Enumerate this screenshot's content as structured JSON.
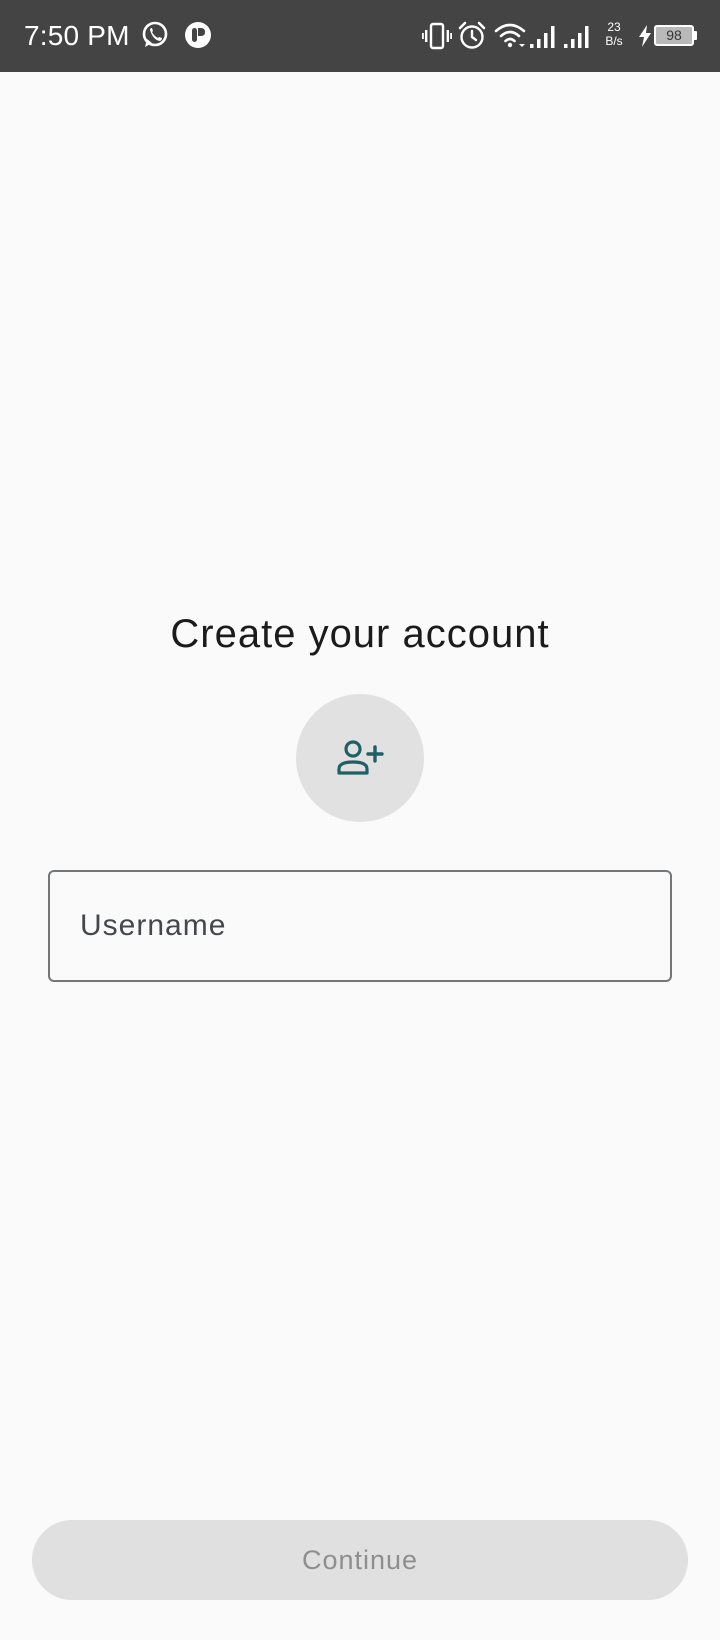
{
  "status_bar": {
    "time": "7:50 PM",
    "icons": [
      "whatsapp-icon",
      "truecaller-icon",
      "vibrate-icon",
      "alarm-icon",
      "wifi-icon",
      "signal-icon",
      "signal-icon",
      "charging-icon"
    ],
    "net_speed_value": "23",
    "net_speed_unit": "B/s",
    "battery_level": "98"
  },
  "main": {
    "title": "Create your account",
    "avatar_icon": "add-person-icon",
    "username_placeholder": "Username",
    "username_value": ""
  },
  "footer": {
    "continue_label": "Continue"
  },
  "colors": {
    "accent": "#1f5f66",
    "background": "#fafafa",
    "status_bar": "#444444",
    "avatar_bg": "#e1e1e1",
    "button_disabled_bg": "#e0e0e0",
    "button_disabled_text": "#8e8e8e"
  }
}
